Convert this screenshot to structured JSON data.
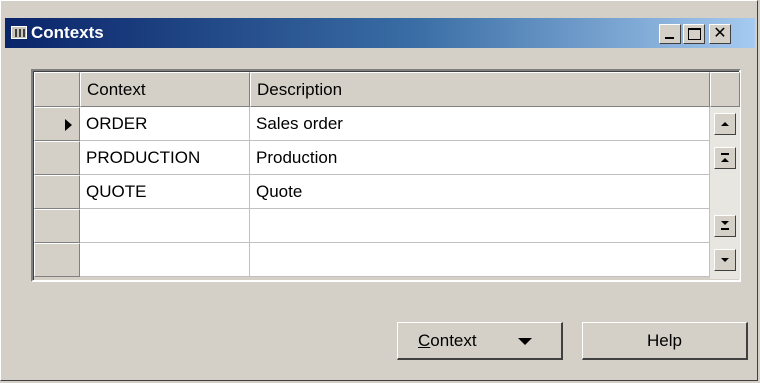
{
  "window": {
    "title": "Contexts",
    "icon": "app-window-icon",
    "controls": {
      "minimize_icon": "minimize-icon",
      "maximize_icon": "maximize-icon",
      "close_label": "✕"
    }
  },
  "grid": {
    "columns": [
      "Context",
      "Description"
    ],
    "rows": [
      {
        "context": "ORDER",
        "description": "Sales order",
        "current": true
      },
      {
        "context": "PRODUCTION",
        "description": "Production",
        "current": false
      },
      {
        "context": "QUOTE",
        "description": "Quote",
        "current": false
      },
      {
        "context": "",
        "description": "",
        "current": false
      },
      {
        "context": "",
        "description": "",
        "current": false
      }
    ]
  },
  "buttons": {
    "context_mnemonic": "C",
    "context_rest": "ontext",
    "help": "Help"
  }
}
